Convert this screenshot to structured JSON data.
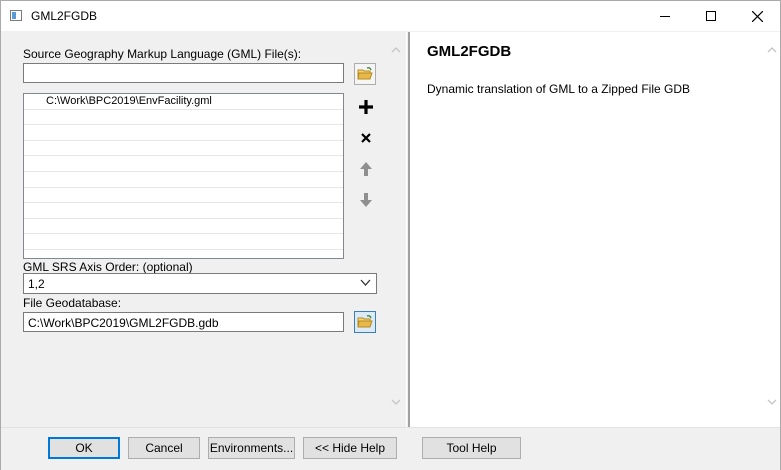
{
  "window": {
    "title": "GML2FGDB",
    "icons": {
      "app": "tool-window-icon",
      "minimize": "minimize-icon",
      "maximize": "maximize-icon",
      "close": "close-icon"
    }
  },
  "form": {
    "source_label": "Source Geography Markup Language (GML) File(s):",
    "source_input_value": "",
    "source_list": [
      "C:\\Work\\BPC2019\\EnvFacility.gml"
    ],
    "axis_label": "GML SRS Axis Order: (optional)",
    "axis_value": "1,2",
    "gdb_label": "File Geodatabase:",
    "gdb_value": "C:\\Work\\BPC2019\\GML2FGDB.gdb"
  },
  "help": {
    "title": "GML2FGDB",
    "description": "Dynamic translation of GML to a Zipped File GDB"
  },
  "buttons": {
    "ok": "OK",
    "cancel": "Cancel",
    "environments": "Environments...",
    "hide_help": "<< Hide Help",
    "tool_help": "Tool Help"
  },
  "colors": {
    "accent": "#0078d7",
    "folder": "#e8b84a"
  }
}
